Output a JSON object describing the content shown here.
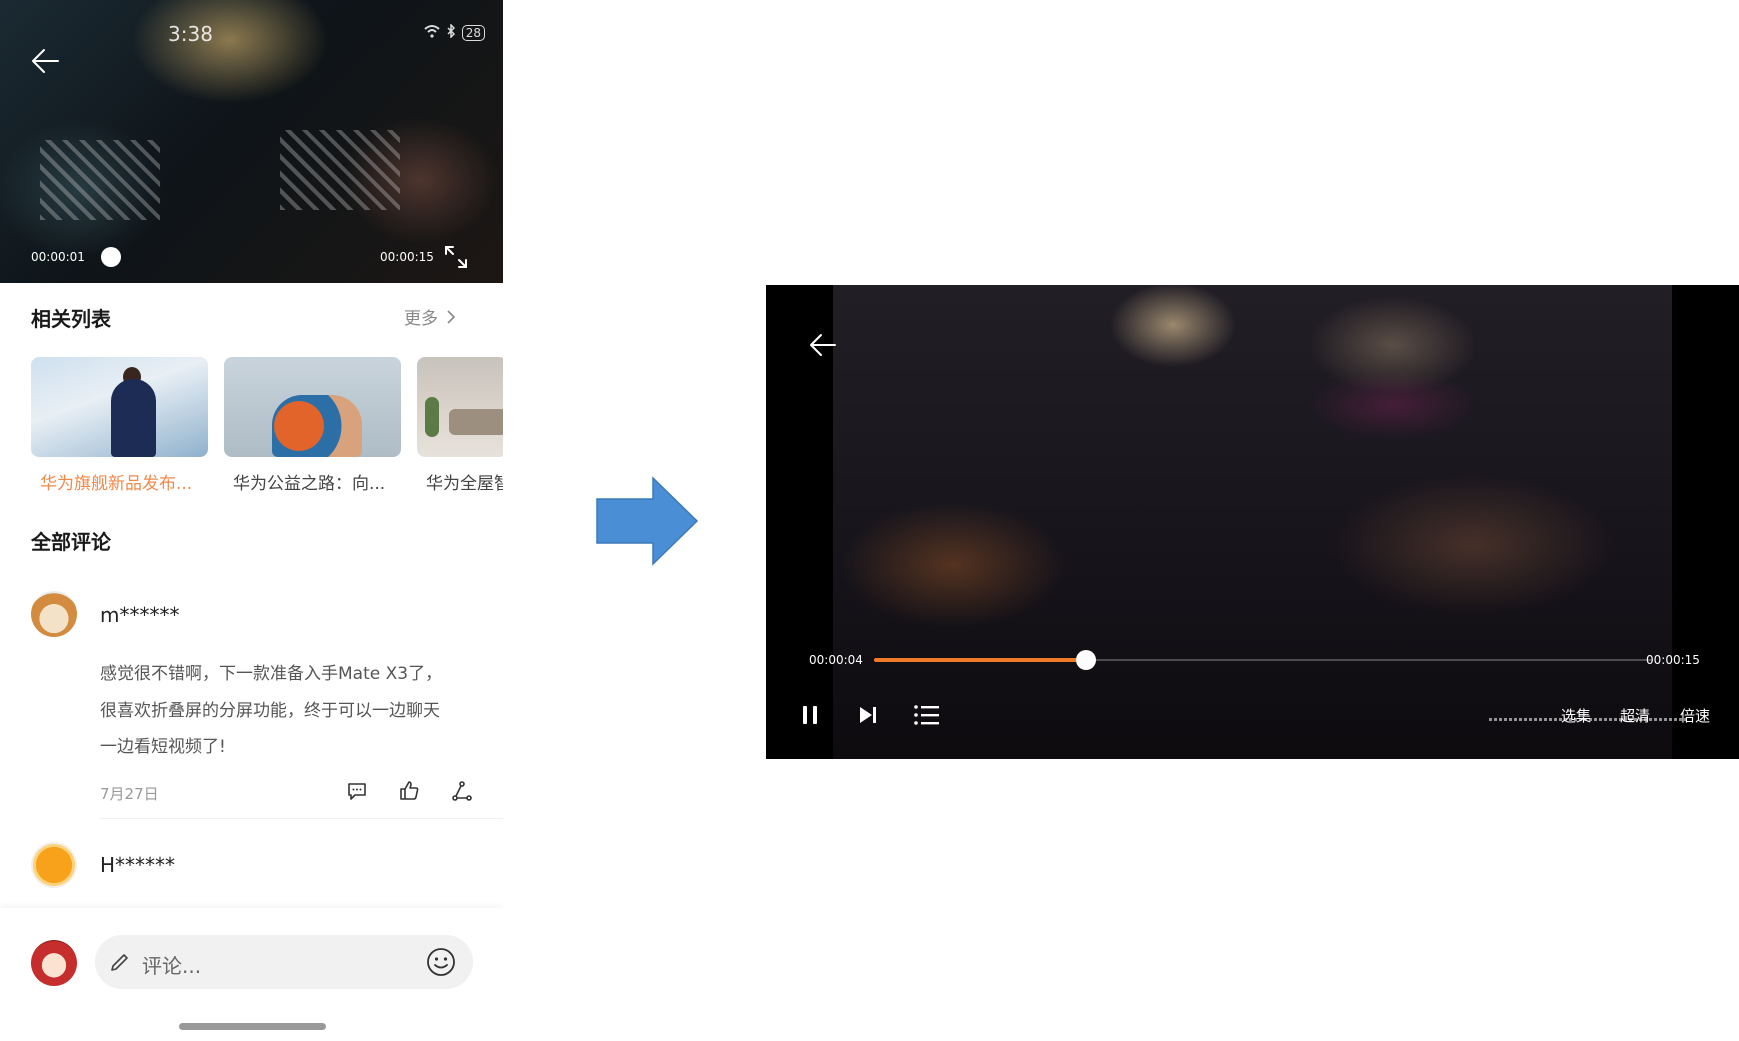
{
  "portrait": {
    "status_bar": {
      "time": "3:38",
      "battery": "28"
    },
    "player": {
      "current_time": "00:00:01",
      "total_time": "00:00:15"
    },
    "related": {
      "title": "相关列表",
      "more_label": "更多",
      "items": [
        {
          "label": "华为旗舰新品发布...",
          "active": true
        },
        {
          "label": "华为公益之路：向...",
          "active": false
        },
        {
          "label": "华为全屋智",
          "active": false
        }
      ]
    },
    "comments_section": {
      "title": "全部评论",
      "comments": [
        {
          "username": "m******",
          "lines": [
            "感觉很不错啊，下一款准备入手Mate X3了，",
            "很喜欢折叠屏的分屏功能，终于可以一边聊天",
            "一边看短视频了!"
          ],
          "date": "7月27日"
        },
        {
          "username": "H******"
        }
      ]
    },
    "comment_input": {
      "placeholder": "评论..."
    }
  },
  "landscape": {
    "current_time": "00:00:04",
    "total_time": "00:00:15",
    "progress": 0.272,
    "buttons": {
      "episodes": "选集",
      "quality": "超清",
      "speed": "倍速"
    }
  },
  "colors": {
    "accent_orange": "#f07a2a",
    "arrow_blue": "#4a8fd6"
  }
}
